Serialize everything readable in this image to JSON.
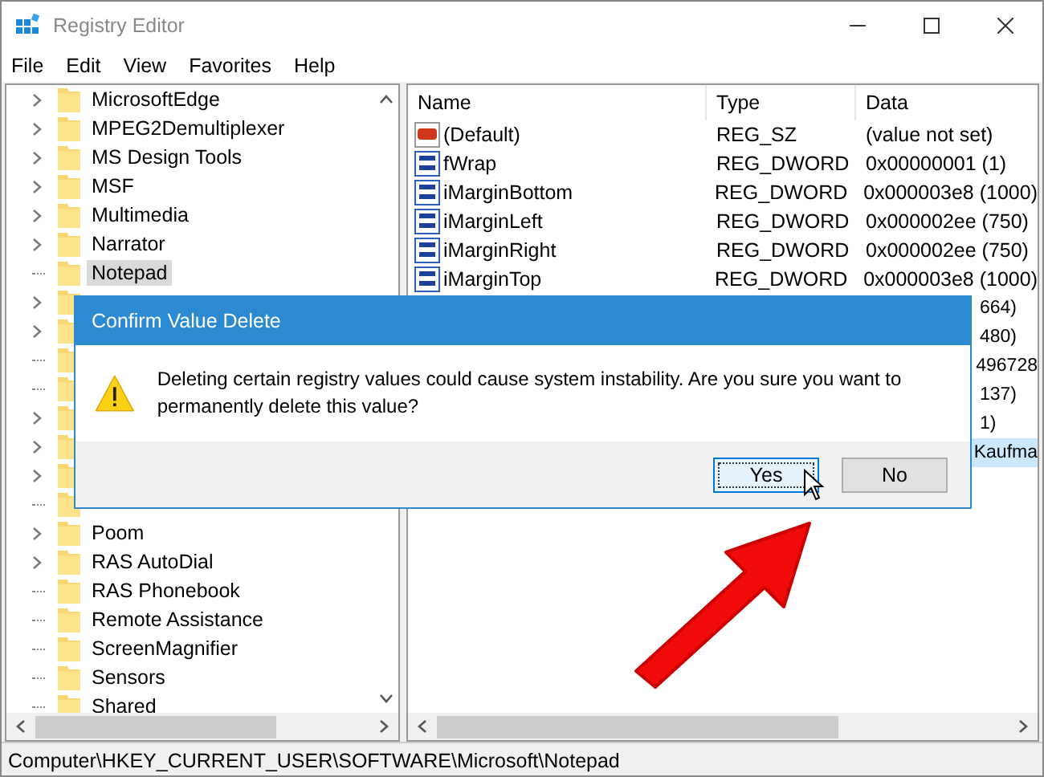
{
  "window": {
    "title": "Registry Editor"
  },
  "menu": [
    {
      "label": "File"
    },
    {
      "label": "Edit"
    },
    {
      "label": "View"
    },
    {
      "label": "Favorites"
    },
    {
      "label": "Help"
    }
  ],
  "tree": {
    "items": [
      {
        "label": "MicrosoftEdge",
        "expander": true,
        "selected": false
      },
      {
        "label": "MPEG2Demultiplexer",
        "expander": true,
        "selected": false
      },
      {
        "label": "MS Design Tools",
        "expander": true,
        "selected": false
      },
      {
        "label": "MSF",
        "expander": true,
        "selected": false
      },
      {
        "label": "Multimedia",
        "expander": true,
        "selected": false
      },
      {
        "label": "Narrator",
        "expander": true,
        "selected": false
      },
      {
        "label": "Notepad",
        "expander": false,
        "selected": true
      },
      {
        "expander": true,
        "selected": false
      },
      {
        "expander": true,
        "selected": false
      },
      {
        "expander": false,
        "selected": false
      },
      {
        "expander": false,
        "selected": false
      },
      {
        "expander": true,
        "selected": false
      },
      {
        "expander": true,
        "selected": false
      },
      {
        "expander": true,
        "selected": false
      },
      {
        "expander": false,
        "selected": false
      },
      {
        "label": "Poom",
        "expander": true,
        "selected": false
      },
      {
        "label": "RAS AutoDial",
        "expander": true,
        "selected": false
      },
      {
        "label": "RAS Phonebook",
        "expander": false,
        "selected": false
      },
      {
        "label": "Remote Assistance",
        "expander": false,
        "selected": false
      },
      {
        "label": "ScreenMagnifier",
        "expander": false,
        "selected": false
      },
      {
        "label": "Sensors",
        "expander": false,
        "selected": false
      },
      {
        "label": "Shared",
        "expander": false,
        "selected": false
      }
    ]
  },
  "table": {
    "columns": [
      "Name",
      "Type",
      "Data"
    ],
    "rows": [
      {
        "kind": "string",
        "name": "(Default)",
        "type": "REG_SZ",
        "data": "(value not set)",
        "selected": false
      },
      {
        "kind": "dword",
        "name": "fWrap",
        "type": "REG_DWORD",
        "data": "0x00000001 (1)",
        "selected": false
      },
      {
        "kind": "dword",
        "name": "iMarginBottom",
        "type": "REG_DWORD",
        "data": "0x000003e8 (1000)",
        "selected": false
      },
      {
        "kind": "dword",
        "name": "iMarginLeft",
        "type": "REG_DWORD",
        "data": "0x000002ee (750)",
        "selected": false
      },
      {
        "kind": "dword",
        "name": "iMarginRight",
        "type": "REG_DWORD",
        "data": "0x000002ee (750)",
        "selected": false
      },
      {
        "kind": "dword",
        "name": "iMarginTop",
        "type": "REG_DWORD",
        "data": "0x000003e8 (1000)",
        "selected": false
      },
      {
        "kind": "covered",
        "data": "664)",
        "selected": false
      },
      {
        "kind": "covered",
        "data": "480)",
        "selected": false
      },
      {
        "kind": "covered",
        "data": "496728",
        "selected": false
      },
      {
        "kind": "covered",
        "data": "137)",
        "selected": false
      },
      {
        "kind": "covered",
        "data": "1)",
        "selected": false
      },
      {
        "kind": "covered",
        "data": "Kaufma",
        "selected": true
      }
    ]
  },
  "dialog": {
    "title": "Confirm Value Delete",
    "message": "Deleting certain registry values could cause system instability. Are you sure you want to permanently delete this value?",
    "buttons": [
      {
        "label": "Yes",
        "focused": true
      },
      {
        "label": "No",
        "focused": false
      }
    ]
  },
  "status_bar": "Computer\\HKEY_CURRENT_USER\\SOFTWARE\\Microsoft\\Notepad"
}
